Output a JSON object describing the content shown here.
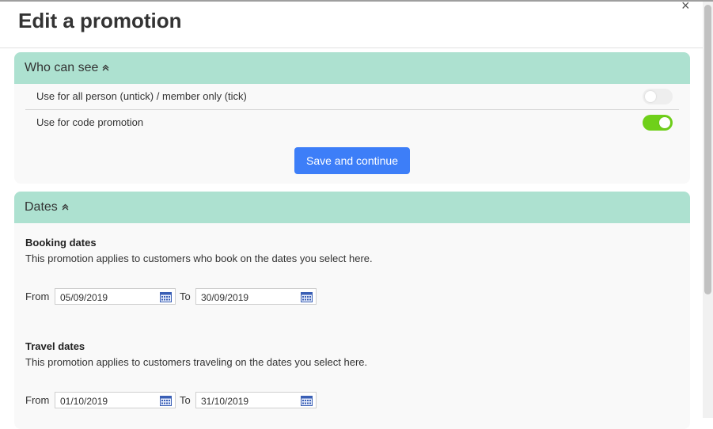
{
  "dialog": {
    "title": "Edit a promotion",
    "close": "×"
  },
  "who_can_see": {
    "heading": "Who can see",
    "chevron": "«",
    "options": [
      {
        "label": "Use for all person (untick) / member only (tick)",
        "enabled": false
      },
      {
        "label": "Use for code promotion",
        "enabled": true
      }
    ],
    "save_button": "Save and continue"
  },
  "dates": {
    "heading": "Dates",
    "chevron": "«",
    "booking": {
      "title": "Booking dates",
      "description": "This promotion applies to customers who book on the dates you select here.",
      "from_label": "From",
      "to_label": "To",
      "from_value": "05/09/2019",
      "to_value": "30/09/2019"
    },
    "travel": {
      "title": "Travel dates",
      "description": "This promotion applies to customers traveling on the dates you select here.",
      "from_label": "From",
      "to_label": "To",
      "from_value": "01/10/2019",
      "to_value": "31/10/2019"
    }
  },
  "colors": {
    "panel_header": "#ade1d0",
    "primary_button": "#3d7ef8",
    "toggle_on": "#6fd01a",
    "toggle_off": "#eeeeee"
  },
  "icons": {
    "calendar": "calendar-icon",
    "close": "close-icon",
    "collapse": "chevron-up-double-icon"
  }
}
